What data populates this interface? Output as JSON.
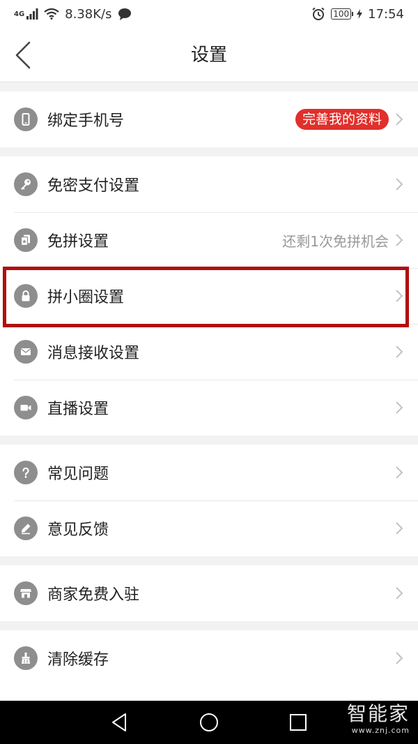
{
  "status_bar": {
    "network": "4G",
    "speed": "8.38K/s",
    "battery": "100",
    "time": "17:54"
  },
  "header": {
    "title": "设置"
  },
  "groups": [
    {
      "items": [
        {
          "label": "绑定手机号",
          "icon": "phone-icon",
          "badge": "完善我的资料"
        }
      ]
    },
    {
      "items": [
        {
          "label": "免密支付设置",
          "icon": "key-icon"
        },
        {
          "label": "免拼设置",
          "icon": "card-icon",
          "value": "还剩1次免拼机会"
        },
        {
          "label": "拼小圈设置",
          "icon": "lock-icon"
        },
        {
          "label": "消息接收设置",
          "icon": "mail-icon"
        },
        {
          "label": "直播设置",
          "icon": "video-camera-icon"
        }
      ]
    },
    {
      "items": [
        {
          "label": "常见问题",
          "icon": "question-icon"
        },
        {
          "label": "意见反馈",
          "icon": "pencil-icon"
        }
      ]
    },
    {
      "items": [
        {
          "label": "商家免费入驻",
          "icon": "store-icon"
        }
      ]
    },
    {
      "items": [
        {
          "label": "清除缓存",
          "icon": "broom-icon"
        }
      ]
    }
  ],
  "watermark": {
    "title": "智能家",
    "url": "www.znj.com"
  },
  "colors": {
    "accent_red": "#e0302b",
    "highlight_border": "#b10d0d",
    "icon_gray": "#8e8e8e"
  }
}
